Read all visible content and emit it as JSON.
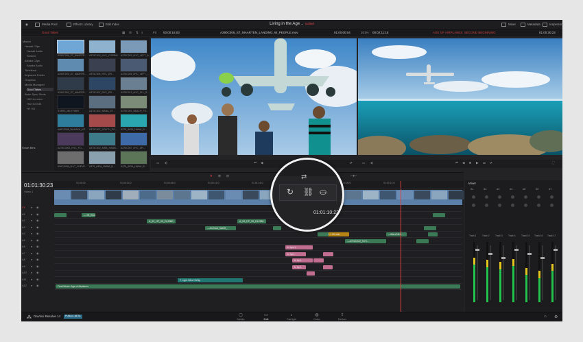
{
  "topbar": {
    "media_pool": "Media Pool",
    "effects_library": "Effects Library",
    "edit_index": "Edit Index",
    "title": "Living in the Age",
    "edited": "Edited",
    "mixer": "Mixer",
    "metadata": "Metadata",
    "inspector": "Inspector"
  },
  "toolbar2": {
    "bin_name": "Good Takes",
    "zoom": "Fit",
    "source_tc": "00:00:16:03",
    "source_clip": "A290C006_ST_MAARTEN_LANDING_W_PEOPLE.mov",
    "dur_tc": "01:00:00:04",
    "zoom2": "101%",
    "prog_tc": "00:02:11:15",
    "timeline_name": "AGE OF AIRPLANES: SECOND BEGINNING",
    "rec_tc": "01:00:30:23"
  },
  "bins": [
    {
      "label": "Master",
      "selected": false
    },
    {
      "label": "Hawaii Clips",
      "selected": false
    },
    {
      "label": "Hawaii Audio",
      "selected": false
    },
    {
      "label": "Selects",
      "selected": false
    },
    {
      "label": "Alaska Clips",
      "selected": false
    },
    {
      "label": "Alaska Audio",
      "selected": false
    },
    {
      "label": "Timelines",
      "selected": false
    },
    {
      "label": "Airplanes Folder",
      "selected": false
    },
    {
      "label": "Graphics",
      "selected": false
    },
    {
      "label": "Media Managed",
      "selected": false
    },
    {
      "label": "Good Takes",
      "selected": true
    },
    {
      "label": "Brain Sync Shots",
      "selected": false
    },
    {
      "label": "H02 for color",
      "selected": false
    },
    {
      "label": "H22 for Edit",
      "selected": false
    },
    {
      "label": "HF VO",
      "selected": false
    }
  ],
  "smart_bins": "Smart Bins",
  "clips": [
    {
      "label": "A290C006_ST_MAARTE...",
      "color": "#6fa6d6"
    },
    {
      "label": "A375C002_NYC_CORRAL...",
      "color": "#8fb2cf"
    },
    {
      "label": "A375C003_NYC_LEFT_A...",
      "color": "#7b9ab8"
    },
    {
      "label": "A290C003_ST_MAARTE...",
      "color": "#5f8bb1"
    },
    {
      "label": "A375C004_NYC_DR...",
      "color": "#3a4050"
    },
    {
      "label": "A375C005_NYC_LEFT_...",
      "color": "#4a5a72"
    },
    {
      "label": "A290C002_ST_MAARTE...",
      "color": "#2f3b48"
    },
    {
      "label": "A375C007_NYC_DR...",
      "color": "#2c4664"
    },
    {
      "label": "A375C013_NYC_FLY_S...",
      "color": "#6a7f92"
    },
    {
      "label": "STARS_MILKYWAY",
      "color": "#10161f"
    },
    {
      "label": "A375C002_MANA_ST...",
      "color": "#5a6e80"
    },
    {
      "label": "A375C003_BEACH_FO...",
      "color": "#7c8a78"
    },
    {
      "label": "A06C0008_MAHAKA_KO...",
      "color": "#2f7d9c"
    },
    {
      "label": "A375C007_SOUTH_PO...",
      "color": "#a54a4a"
    },
    {
      "label": "A375_AIRA_HAWA_B...",
      "color": "#2aa6b0"
    },
    {
      "label": "A375C0001_NYC_FO...",
      "color": "#4b3a5c"
    },
    {
      "label": "A375C002_AIRA_HAWA...",
      "color": "#3d7a8a"
    },
    {
      "label": "A375C007_NYC_DR...",
      "color": "#3f6aa8"
    },
    {
      "label": "A06C0006_NYC_CHEVE...",
      "color": "#6d6d6d"
    },
    {
      "label": "A375_AIRA_HAWA_B...",
      "color": "#8aa0ae"
    },
    {
      "label": "A375_AIRA_HAWA_B...",
      "color": "#5c7458"
    }
  ],
  "viewer": {
    "source_tc": "",
    "program_tc": ""
  },
  "timeline": {
    "timecode": "01:01:30:23",
    "ruler_ticks": [
      "01:00:00",
      "01:00:24:0",
      "01:00:48:0",
      "01:00:12:0",
      "01:01:16:0",
      "01:01:45:3",
      "01:02:00:0",
      "01:02:12:0"
    ],
    "video_track": "Video 1",
    "tracks": [
      "V1",
      "A1",
      "A2",
      "A3",
      "A4",
      "A5",
      "A6",
      "A7",
      "A8",
      "A9",
      "A10",
      "A11",
      "A12"
    ],
    "clips": [
      {
        "label": "— Mt_Broken...",
        "color": "green",
        "track": 1
      },
      {
        "label": "A_02_HP_V0_D12380",
        "color": "green",
        "track": 2
      },
      {
        "label": "A_02_HP_V0_D12380",
        "color": "green",
        "track": 2
      },
      {
        "label": "A_02_HP_V0_D12380",
        "color": "green",
        "track": 2
      },
      {
        "label": "—Archival_Nat08_",
        "color": "green",
        "track": 3
      },
      {
        "label": "DH-3.1 99 mile",
        "color": "gold",
        "track": 4
      },
      {
        "label": "—MarxDNA...",
        "color": "green",
        "track": 4
      },
      {
        "label": "—A701C022_NYC...",
        "color": "green",
        "track": 5
      },
      {
        "label": "fx hpx-1",
        "color": "pink",
        "track": 6
      },
      {
        "label": "fx hp-1",
        "color": "pink",
        "track": 7
      },
      {
        "label": "fx hp-1",
        "color": "pink",
        "track": 8
      },
      {
        "label": "fx hp-1",
        "color": "pink",
        "track": 9
      },
      {
        "label": "T. Light Wind+Whip",
        "color": "teal",
        "track": 11
      },
      {
        "label": "Final Music: Age of Airplanes",
        "color": "green",
        "track": 12
      }
    ]
  },
  "mixer": {
    "title": "Mixer",
    "channels": [
      "A1",
      "A2",
      "A3",
      "A4",
      "A5",
      "A6",
      "A7"
    ],
    "tracks": [
      "Track 1",
      "Track 2",
      "Track 3",
      "Track 4",
      "Track 15",
      "Track 16",
      "Track 17"
    ],
    "levels": [
      0.62,
      0.58,
      0.55,
      0.6,
      0.45,
      0.4,
      0.52
    ]
  },
  "magnifier": {
    "timecode": "01:01:10:22"
  },
  "bottom": {
    "app_name": "DaVinci Resolve 14",
    "beta": "PUBLIC BETA",
    "pages": [
      "Media",
      "Edit",
      "Fairlight",
      "Color",
      "Deliver"
    ],
    "active_page": "Edit"
  },
  "colors": {
    "accent": "#e34040",
    "clip_green": "#3c7a57",
    "clip_pink": "#c26e90",
    "clip_gold": "#b58415",
    "meter_green": "#22c24d",
    "meter_yellow": "#e2c51f"
  }
}
